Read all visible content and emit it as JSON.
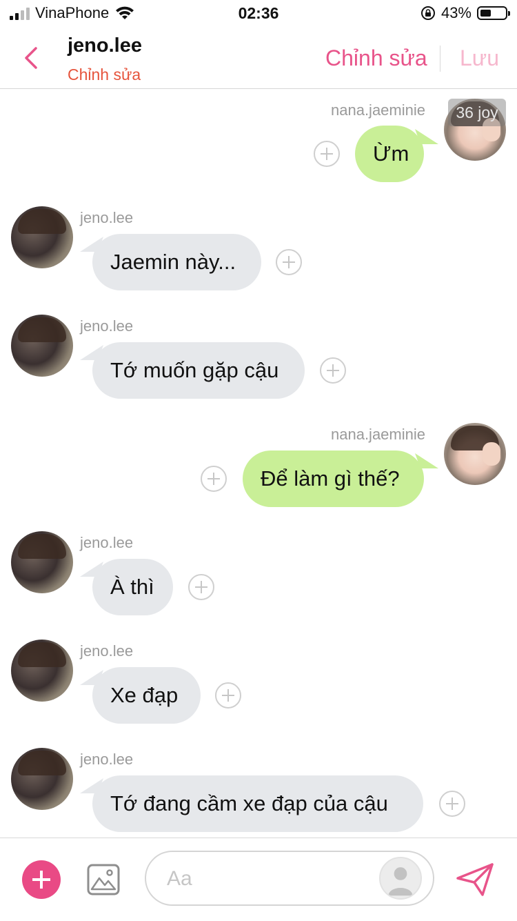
{
  "status_bar": {
    "carrier": "VinaPhone",
    "time": "02:36",
    "battery_percent": "43%"
  },
  "header": {
    "contact_name": "jeno.lee",
    "subtitle": "Chỉnh sửa",
    "edit_label": "Chỉnh sửa",
    "save_label": "Lưu"
  },
  "watermark": "36 joy",
  "messages": [
    {
      "sender": "nana.jaeminie",
      "text": "Ừm",
      "direction": "outgoing"
    },
    {
      "sender": "jeno.lee",
      "text": "Jaemin này...",
      "direction": "incoming"
    },
    {
      "sender": "jeno.lee",
      "text": "Tớ muốn gặp cậu",
      "direction": "incoming"
    },
    {
      "sender": "nana.jaeminie",
      "text": "Để làm gì thế?",
      "direction": "outgoing"
    },
    {
      "sender": "jeno.lee",
      "text": "À thì",
      "direction": "incoming"
    },
    {
      "sender": "jeno.lee",
      "text": "Xe đạp",
      "direction": "incoming"
    },
    {
      "sender": "jeno.lee",
      "text": "Tớ đang cầm xe đạp của cậu",
      "direction": "incoming"
    }
  ],
  "input": {
    "placeholder": "Aa",
    "value": ""
  },
  "icons": {
    "back": "chevron-left-icon",
    "add": "plus-icon",
    "image": "image-icon",
    "send": "paper-plane-icon",
    "react": "plus-circle-icon"
  },
  "colors": {
    "accent_pink": "#e8548a",
    "subtitle_red": "#e6543c",
    "save_disabled": "#f6b7cd",
    "outgoing_bubble": "#c9ef97",
    "incoming_bubble": "#e6e8eb"
  }
}
